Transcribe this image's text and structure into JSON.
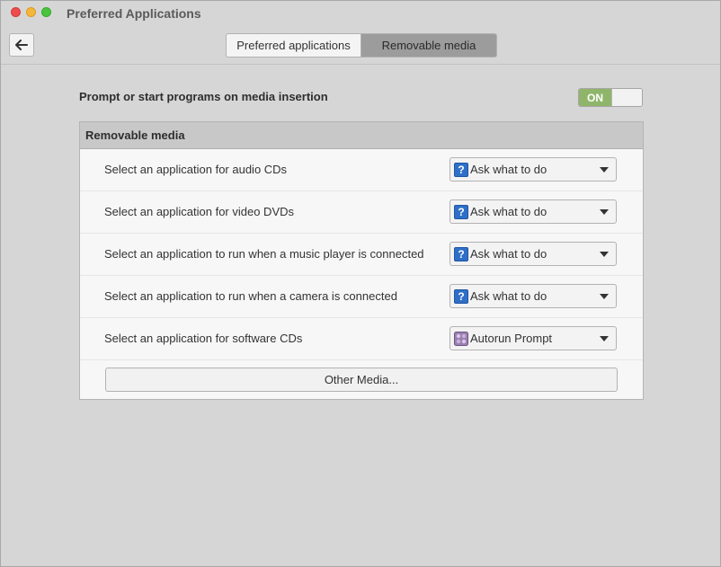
{
  "window": {
    "title": "Preferred Applications",
    "colors": {
      "close": "#ee4d4d",
      "minimize": "#f4b73b",
      "maximize": "#49c43c"
    }
  },
  "toolbar": {
    "back_icon": "arrow-left-icon",
    "tabs": [
      {
        "label": "Preferred applications",
        "selected": false
      },
      {
        "label": "Removable media",
        "selected": true
      }
    ]
  },
  "prompt": {
    "label": "Prompt or start programs on media insertion",
    "toggle_state": "ON",
    "toggle_color": "#8fb56a"
  },
  "panel": {
    "header": "Removable media",
    "rows": [
      {
        "label": "Select an application for audio CDs",
        "value": "Ask what to do",
        "icon": "question-icon"
      },
      {
        "label": "Select an application for video DVDs",
        "value": "Ask what to do",
        "icon": "question-icon"
      },
      {
        "label": "Select an application to run when a music player is connected",
        "value": "Ask what to do",
        "icon": "question-icon"
      },
      {
        "label": "Select an application to run when a camera is connected",
        "value": "Ask what to do",
        "icon": "question-icon"
      },
      {
        "label": "Select an application for software CDs",
        "value": "Autorun Prompt",
        "icon": "autorun-icon"
      }
    ],
    "other_button": "Other Media..."
  }
}
